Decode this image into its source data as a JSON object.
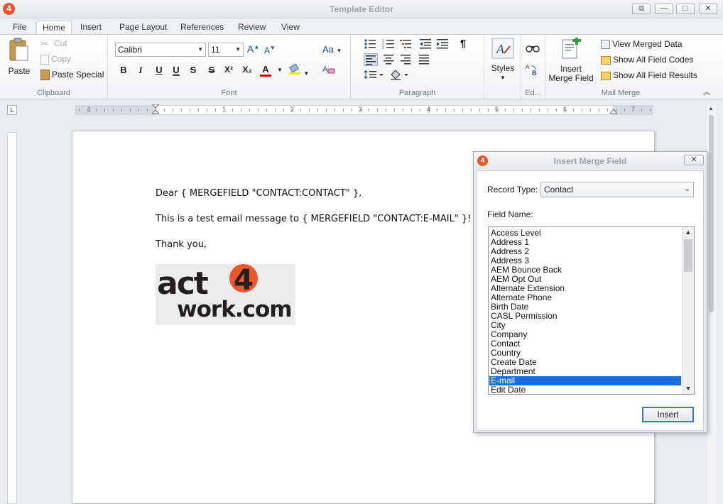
{
  "window": {
    "title": "Template Editor",
    "logo_text": "4",
    "controls": {
      "restore": "⧉",
      "minimize": "—",
      "maximize": "□",
      "close": "✕"
    }
  },
  "tabs": [
    {
      "label": "File",
      "active": false
    },
    {
      "label": "Home",
      "active": true
    },
    {
      "label": "Insert",
      "active": false
    },
    {
      "label": "Page Layout",
      "active": false
    },
    {
      "label": "References",
      "active": false
    },
    {
      "label": "Review",
      "active": false
    },
    {
      "label": "View",
      "active": false
    }
  ],
  "ribbon": {
    "clipboard": {
      "group_label": "Clipboard",
      "paste": "Paste",
      "cut": "Cut",
      "copy": "Copy",
      "paste_special": "Paste Special"
    },
    "font": {
      "group_label": "Font",
      "font_name": "Calibri",
      "font_size": "11",
      "bold": "B",
      "italic": "I",
      "underline": "U",
      "double_underline": "U",
      "strike": "S",
      "double_strike": "S",
      "superscript": "X²",
      "subscript": "X₂",
      "font_color": "A",
      "grow": "A",
      "shrink": "A",
      "change_case": "Aa"
    },
    "paragraph": {
      "group_label": "Paragraph",
      "pilcrow": "¶"
    },
    "styles": {
      "label": "Styles"
    },
    "editing": {
      "group_label": "Ed..."
    },
    "mail_merge": {
      "group_label": "Mail Merge",
      "insert_merge_field": "Insert Merge Field",
      "view_merged_data": "View Merged Data",
      "show_field_codes": "Show All Field Codes",
      "show_field_results": "Show All Field Results"
    }
  },
  "ruler": {
    "corner": "L",
    "numbers": [
      "1",
      "1",
      "2",
      "3",
      "4",
      "5",
      "6",
      "7"
    ]
  },
  "document": {
    "line1": "Dear { MERGEFIELD \"CONTACT:CONTACT\" },",
    "line2": "This is a test email message to { MERGEFIELD \"CONTACT:E-MAIL\" }!",
    "line3": "Thank you,",
    "logo_text_act": "act",
    "logo_text_four": "4",
    "logo_text_work": "work.com"
  },
  "dialog": {
    "title": "Insert Merge Field",
    "logo_text": "4",
    "close": "✕",
    "record_type_label": "Record Type:",
    "record_type_value": "Contact",
    "field_name_label": "Field Name:",
    "fields": [
      "Access Level",
      "Address 1",
      "Address 2",
      "Address 3",
      "AEM Bounce Back",
      "AEM Opt Out",
      "Alternate Extension",
      "Alternate Phone",
      "Birth Date",
      "CASL Permission",
      "City",
      "Company",
      "Contact",
      "Country",
      "Create Date",
      "Department",
      "E-mail",
      "Edit Date"
    ],
    "selected_field": "E-mail",
    "insert_button": "Insert"
  },
  "colors": {
    "accent": "#1a70d2",
    "brand": "#e8552a"
  }
}
